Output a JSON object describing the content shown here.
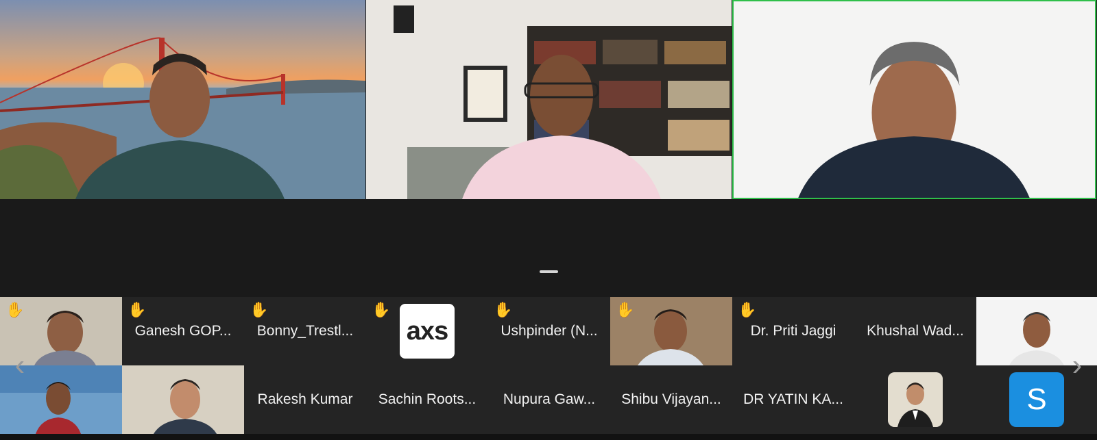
{
  "speakers": [
    {
      "id": "speaker-1",
      "background": "golden-gate-bridge"
    },
    {
      "id": "speaker-2",
      "background": "bookshelf-room"
    },
    {
      "id": "speaker-3",
      "background": "white-wall",
      "active": true
    }
  ],
  "colors": {
    "active_border": "#2fbf4a",
    "hand": "#f3c44c",
    "s_avatar": "#1b8fe0"
  },
  "gallery": {
    "row1": [
      {
        "type": "video",
        "hand": true
      },
      {
        "type": "name",
        "hand": true,
        "label": "Ganesh GOP..."
      },
      {
        "type": "name",
        "hand": true,
        "label": "Bonny_Trestl..."
      },
      {
        "type": "logo",
        "hand": true,
        "logo_text": "axs"
      },
      {
        "type": "name",
        "hand": true,
        "label": "Ushpinder (N..."
      },
      {
        "type": "video",
        "hand": true
      },
      {
        "type": "name",
        "hand": true,
        "label": "Dr. Priti Jaggi"
      },
      {
        "type": "name",
        "hand": false,
        "label": "Khushal Wad..."
      },
      {
        "type": "video",
        "hand": false
      }
    ],
    "row2": [
      {
        "type": "video"
      },
      {
        "type": "video"
      },
      {
        "type": "name",
        "label": "Rakesh Kumar"
      },
      {
        "type": "name",
        "label": "Sachin Roots..."
      },
      {
        "type": "name",
        "label": "Nupura Gaw..."
      },
      {
        "type": "name",
        "label": "Shibu Vijayan..."
      },
      {
        "type": "name",
        "label": "DR YATIN KA..."
      },
      {
        "type": "avatar"
      },
      {
        "type": "letter",
        "letter": "S"
      }
    ]
  },
  "icons": {
    "hand": "raised-hand-icon",
    "prev": "chevron-left-icon",
    "next": "chevron-right-icon"
  },
  "nav": {
    "prev": "‹",
    "next": "›"
  },
  "hand_glyph": "✋"
}
